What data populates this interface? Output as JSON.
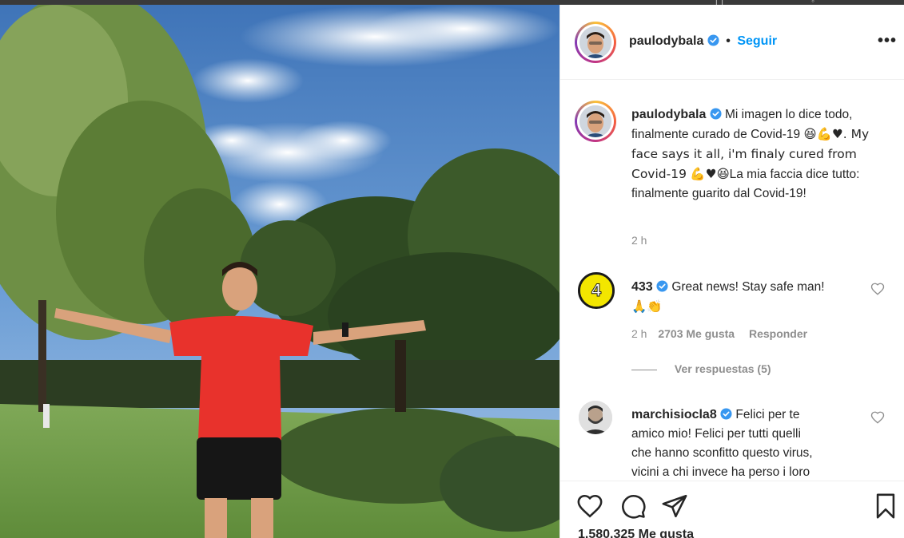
{
  "post": {
    "username": "paulodybala",
    "follow_label": "Seguir",
    "more_label": "•••",
    "caption_parts": [
      "Mi imagen lo dice todo, finalmente curado de Covid-19",
      "😆💪♥. My face says it all, i'm finaly cured from Covid-19",
      "💪♥😆",
      "La mia faccia dice tutto: finalmente guarito dal Covid-19!"
    ],
    "caption_time": "2 h",
    "likes": "1.580.325 Me gusta"
  },
  "comments": [
    {
      "username": "433",
      "avatar_text": "4",
      "text": "Great news! Stay safe man!",
      "emoji": "🙏👏",
      "time": "2 h",
      "likes": "2703 Me gusta",
      "reply_label": "Responder",
      "view_replies": "Ver respuestas (5)"
    },
    {
      "username": "marchisiocla8",
      "text_lines": [
        "Felici per te",
        "amico mio! Felici per tutti quelli",
        "che hanno sconfitto questo virus,",
        "vicini a chi invece ha perso i loro"
      ]
    }
  ],
  "colors": {
    "accent": "#0095f6",
    "verified": "#3897f0",
    "text": "#262626",
    "muted": "#8e8e8e",
    "shirt": "#e8322c"
  },
  "icons": [
    "verified-badge-icon",
    "more-options-icon",
    "heart-icon",
    "comment-icon",
    "share-icon",
    "bookmark-icon"
  ]
}
